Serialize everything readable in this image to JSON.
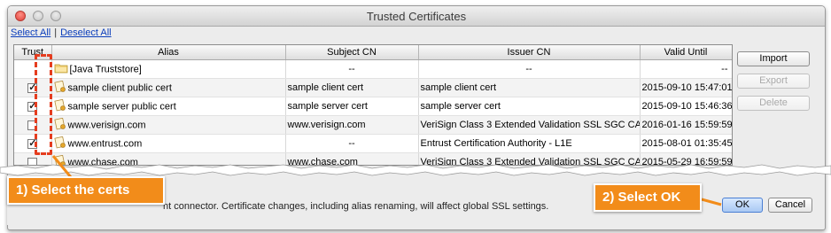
{
  "window": {
    "title": "Trusted Certificates"
  },
  "links": {
    "select_all": "Select All",
    "separator": "|",
    "deselect_all": "Deselect All"
  },
  "table": {
    "columns": [
      "Trust",
      "Alias",
      "Subject CN",
      "Issuer CN",
      "Valid Until"
    ],
    "rows": [
      {
        "trust": null,
        "icon": "folder-icon",
        "alias": "[Java Truststore]",
        "subject": "--",
        "issuer": "--",
        "valid": "--"
      },
      {
        "trust": true,
        "icon": "certificate-icon",
        "alias": "sample client public cert",
        "subject": "sample client cert",
        "issuer": "sample client cert",
        "valid": "2015-09-10 15:47:01"
      },
      {
        "trust": true,
        "icon": "certificate-icon",
        "alias": "sample server public cert",
        "subject": "sample server cert",
        "issuer": "sample server cert",
        "valid": "2015-09-10 15:46:36"
      },
      {
        "trust": false,
        "icon": "certificate-icon",
        "alias": "www.verisign.com",
        "subject": "www.verisign.com",
        "issuer": "VeriSign Class 3 Extended Validation SSL SGC CA",
        "valid": "2016-01-16 15:59:59"
      },
      {
        "trust": true,
        "icon": "certificate-icon",
        "alias": "www.entrust.com",
        "subject": "--",
        "issuer": "Entrust Certification Authority - L1E",
        "valid": "2015-08-01 01:35:45"
      },
      {
        "trust": false,
        "icon": "certificate-icon",
        "alias": "www.chase.com",
        "subject": "www.chase.com",
        "issuer": "VeriSign Class 3 Extended Validation SSL SGC CA",
        "valid": "2015-05-29 16:59:59"
      }
    ]
  },
  "buttons": {
    "import": "Import",
    "export": "Export",
    "delete": "Delete",
    "ok": "OK",
    "cancel": "Cancel"
  },
  "status": "nt connector. Certificate changes, including alias renaming, will affect global SSL settings.",
  "callouts": {
    "select_certs": "1) Select the certs",
    "select_ok": "2) Select OK"
  },
  "colors": {
    "callout": "#f28c1a",
    "highlight": "#e53c1e",
    "link": "#0a3dbb"
  }
}
